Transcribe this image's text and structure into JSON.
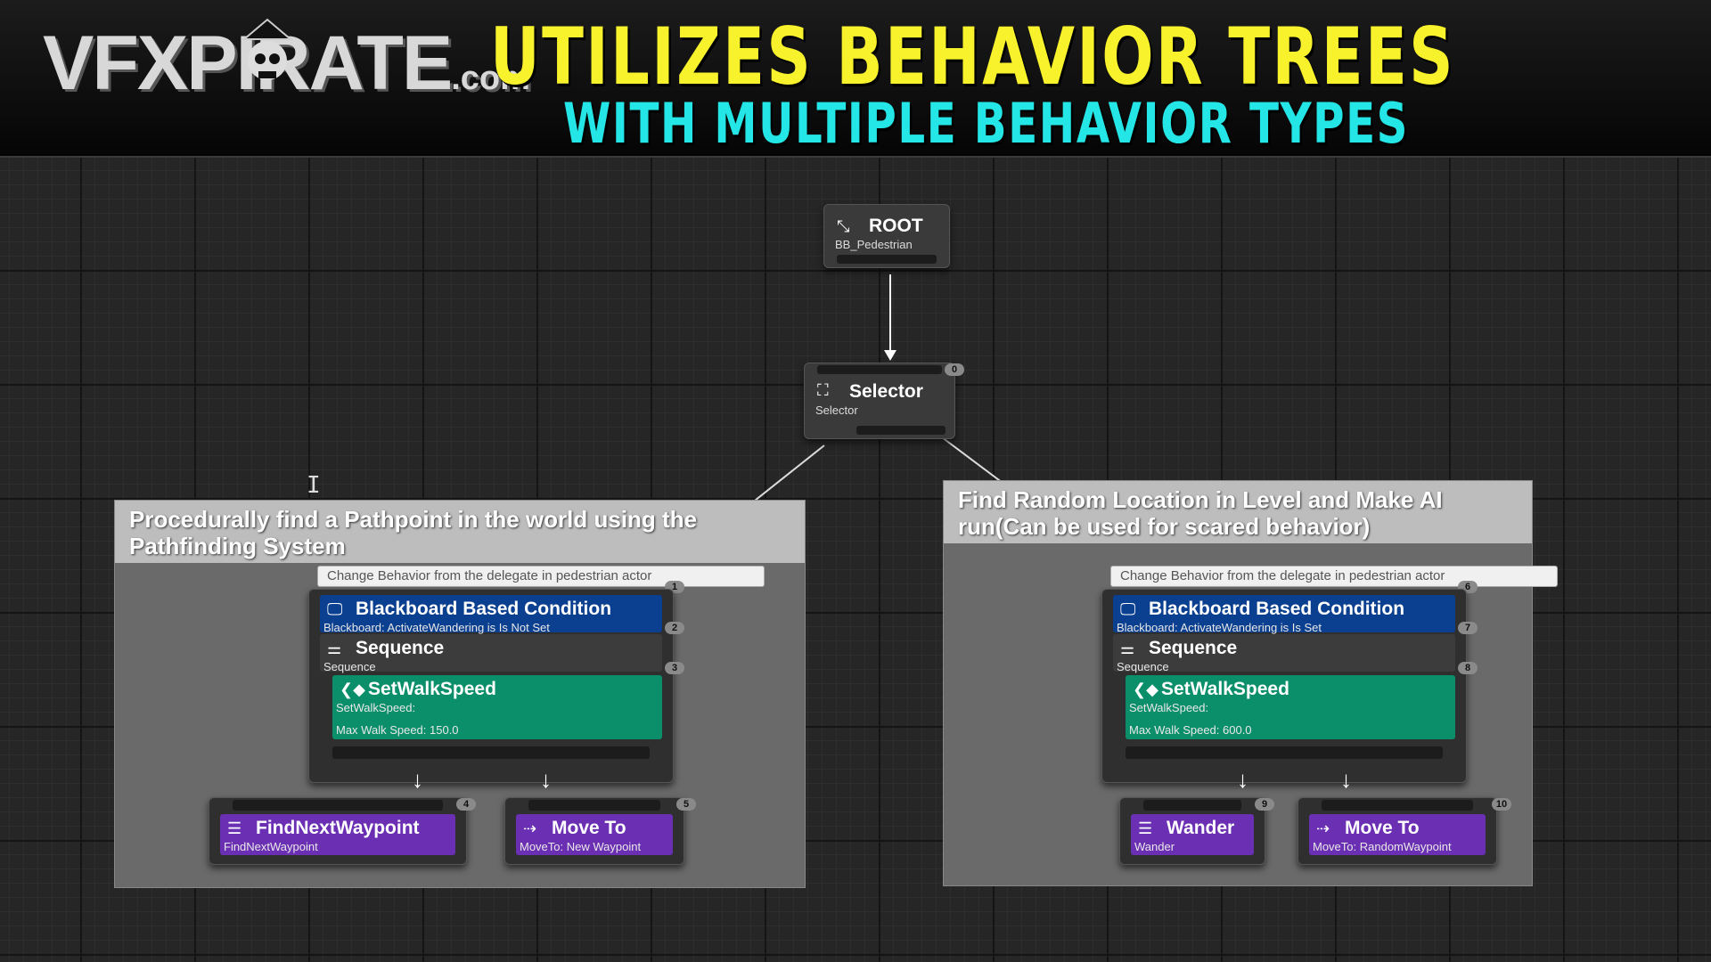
{
  "banner": {
    "logo_text": "VFXPIRATE",
    "logo_suffix": ".com",
    "title_line1": "UTILIZES BEHAVIOR TREES",
    "title_line2": "WITH MULTIPLE BEHAVIOR TYPES",
    "colors": {
      "title1": "#f7f22c",
      "title2": "#25e6e6"
    }
  },
  "graph": {
    "root": {
      "title": "ROOT",
      "subtitle": "BB_Pedestrian",
      "icon": "root-icon"
    },
    "selector": {
      "title": "Selector",
      "subtitle": "Selector",
      "index": "0",
      "icon": "selector-icon"
    },
    "left_branch": {
      "comment": "Procedurally find a Pathpoint in the world using the Pathfinding System",
      "note": "Change Behavior from the delegate in pedestrian actor",
      "note_index": "1",
      "decorator": {
        "title": "Blackboard Based Condition",
        "subtitle": "Blackboard: ActivateWandering is Is Not Set",
        "index": "2"
      },
      "composite": {
        "title": "Sequence",
        "subtitle": "Sequence",
        "index": "3"
      },
      "service": {
        "title": "SetWalkSpeed",
        "line1": "SetWalkSpeed:",
        "line2": "Max Walk Speed: 150.0"
      },
      "task_a": {
        "title": "FindNextWaypoint",
        "subtitle": "FindNextWaypoint",
        "index": "4"
      },
      "task_b": {
        "title": "Move To",
        "subtitle": "MoveTo: New Waypoint",
        "index": "5"
      }
    },
    "right_branch": {
      "comment": "Find Random Location in Level and Make AI run(Can be used for scared behavior)",
      "note": "Change Behavior from the delegate in pedestrian actor",
      "note_index": "6",
      "decorator": {
        "title": "Blackboard Based Condition",
        "subtitle": "Blackboard: ActivateWandering is Is Set",
        "index": "7"
      },
      "composite": {
        "title": "Sequence",
        "subtitle": "Sequence",
        "index": "8"
      },
      "service": {
        "title": "SetWalkSpeed",
        "line1": "SetWalkSpeed:",
        "line2": "Max Walk Speed: 600.0"
      },
      "task_a": {
        "title": "Wander",
        "subtitle": "Wander",
        "index": "9"
      },
      "task_b": {
        "title": "Move To",
        "subtitle": "MoveTo: RandomWaypoint",
        "index": "10"
      }
    }
  },
  "colors": {
    "decorator": "#0b3f8f",
    "service": "#0a8f6a",
    "task": "#6b2fb3",
    "node": "#3a3a3a"
  }
}
